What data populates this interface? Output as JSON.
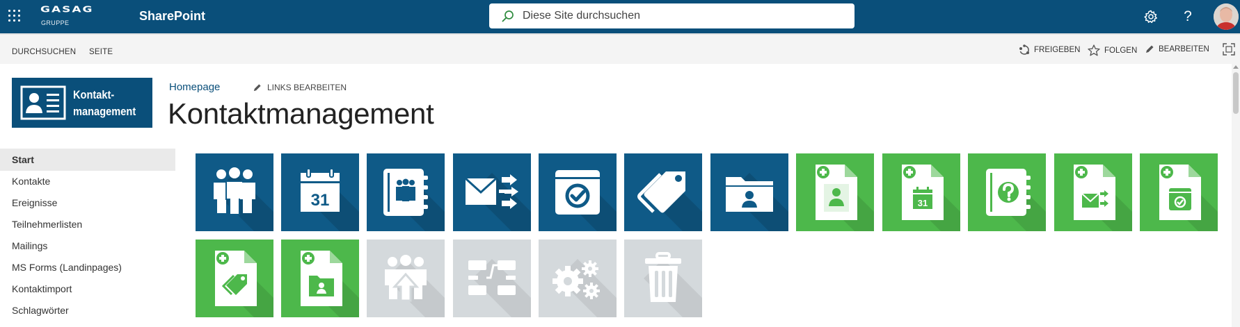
{
  "suitebar": {
    "brand_name": "GASAG",
    "brand_sub": "GRUPPE",
    "app_name": "SharePoint",
    "search_placeholder": "Diese Site durchsuchen",
    "icons": [
      "app-launcher-icon",
      "settings-icon",
      "help-icon",
      "user-avatar"
    ],
    "help_glyph": "?"
  },
  "ribbon": {
    "tabs": [
      "DURCHSUCHEN",
      "SEITE"
    ],
    "actions": [
      {
        "label": "FREIGEBEN",
        "icon": "share-icon"
      },
      {
        "label": "FOLGEN",
        "icon": "star-icon"
      },
      {
        "label": "BEARBEITEN",
        "icon": "pencil-icon"
      }
    ],
    "focus_icon": "focus-mode-icon"
  },
  "site": {
    "logo_text_line1": "Kontakt-",
    "logo_text_line2": "management",
    "breadcrumb": "Homepage",
    "edit_links": "LINKS BEARBEITEN",
    "title": "Kontaktmanagement"
  },
  "nav": {
    "items": [
      {
        "label": "Start",
        "active": true
      },
      {
        "label": "Kontakte"
      },
      {
        "label": "Ereignisse"
      },
      {
        "label": "Teilnehmerlisten"
      },
      {
        "label": "Mailings"
      },
      {
        "label": "MS Forms (Landinpages)"
      },
      {
        "label": "Kontaktimport"
      },
      {
        "label": "Schlagwörter"
      }
    ]
  },
  "tiles": {
    "colors": {
      "blue": "#0f5a87",
      "green": "#4db84b",
      "gray": "#d4d9dc"
    },
    "calendar_day": "31",
    "row1": [
      {
        "icon": "people-group-icon",
        "color": "blue"
      },
      {
        "icon": "calendar-icon",
        "color": "blue"
      },
      {
        "icon": "address-book-icon",
        "color": "blue"
      },
      {
        "icon": "mail-distribution-icon",
        "color": "blue"
      },
      {
        "icon": "event-check-icon",
        "color": "blue"
      },
      {
        "icon": "tag-icon",
        "color": "blue"
      },
      {
        "icon": "contact-folder-icon",
        "color": "blue"
      },
      {
        "icon": "new-contact-icon",
        "color": "green"
      },
      {
        "icon": "new-event-icon",
        "color": "green"
      },
      {
        "icon": "new-help-book-icon",
        "color": "green"
      },
      {
        "icon": "new-mailing-icon",
        "color": "green"
      },
      {
        "icon": "new-registration-icon",
        "color": "green"
      }
    ],
    "row2": [
      {
        "icon": "new-tag-icon",
        "color": "green"
      },
      {
        "icon": "new-contact-folder-icon",
        "color": "green"
      },
      {
        "icon": "contact-import-icon",
        "color": "gray"
      },
      {
        "icon": "workflow-icon",
        "color": "gray"
      },
      {
        "icon": "settings-gears-icon",
        "color": "gray"
      },
      {
        "icon": "trash-icon",
        "color": "gray"
      }
    ]
  }
}
